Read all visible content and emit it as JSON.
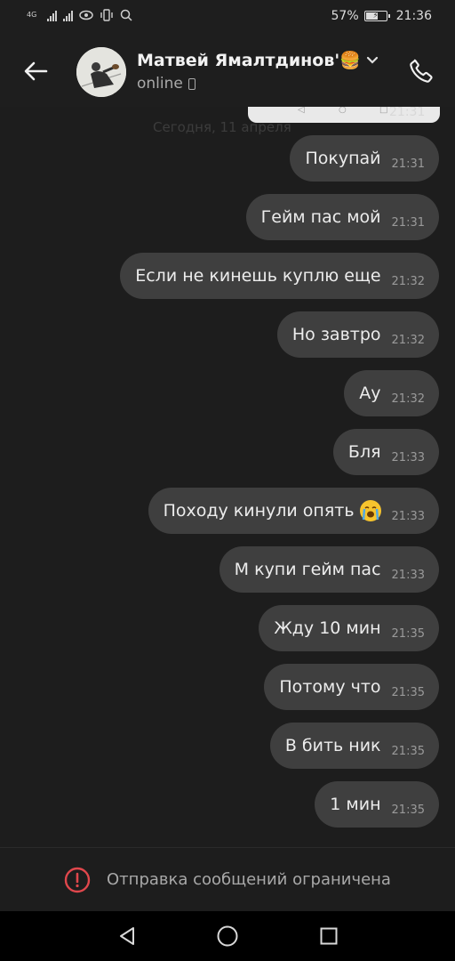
{
  "status_bar": {
    "network_label": "4G",
    "battery_percent": "57%",
    "time": "21:36"
  },
  "header": {
    "contact_name": "Матвей Ямалтдинов'🍔",
    "status": "online",
    "icons": {
      "back": "arrow-left-icon",
      "chevron": "chevron-down-icon",
      "call": "phone-icon"
    }
  },
  "previous_message_time": "21:31",
  "date_separator": "Сегодня, 11 апреля",
  "messages": [
    {
      "text": "Покупай",
      "time": "21:31"
    },
    {
      "text": "Гейм пас мой",
      "time": "21:31"
    },
    {
      "text": "Если не кинешь куплю еще",
      "time": "21:32"
    },
    {
      "text": "Но завтро",
      "time": "21:32"
    },
    {
      "text": "Ау",
      "time": "21:32"
    },
    {
      "text": "Бля",
      "time": "21:33"
    },
    {
      "text": "Походу кинули опять",
      "time": "21:33",
      "emoji": "crying-face-emoji"
    },
    {
      "text": "М купи гейм пас",
      "time": "21:33"
    },
    {
      "text": "Жду 10 мин",
      "time": "21:35"
    },
    {
      "text": "Потому что",
      "time": "21:35"
    },
    {
      "text": "В бить ник",
      "time": "21:35"
    },
    {
      "text": "1 мин",
      "time": "21:35"
    }
  ],
  "restriction": {
    "text": "Отправка сообщений ограничена",
    "icon": "alert-circle-icon",
    "icon_color": "#e0474c"
  },
  "nav_bar": {
    "buttons": [
      "back-triangle-icon",
      "home-circle-icon",
      "recents-square-icon"
    ]
  },
  "colors": {
    "background": "#1d1d1d",
    "bubble": "#3f3f3f",
    "text": "#ececec",
    "timestamp": "#9a9a9a"
  }
}
